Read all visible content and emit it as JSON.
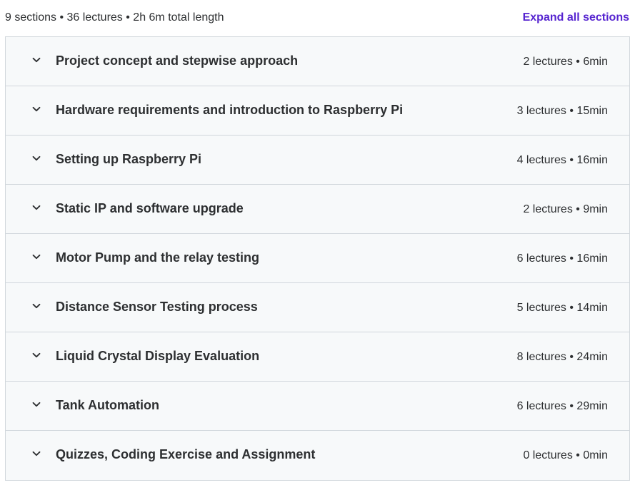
{
  "summary": {
    "text": "9 sections • 36 lectures • 2h 6m total length",
    "expand_label": "Expand all sections"
  },
  "colors": {
    "accent": "#5624d0",
    "text": "#2d2f31",
    "section_bg": "#f7f9fa",
    "border": "#d1d7dc"
  },
  "sections": [
    {
      "title": "Project concept and stepwise approach",
      "meta": "2 lectures • 6min",
      "icon": "chevron-down-icon"
    },
    {
      "title": "Hardware requirements and introduction to Raspberry Pi",
      "meta": "3 lectures • 15min",
      "icon": "chevron-down-icon"
    },
    {
      "title": "Setting up Raspberry Pi",
      "meta": "4 lectures • 16min",
      "icon": "chevron-down-icon"
    },
    {
      "title": "Static IP and software upgrade",
      "meta": "2 lectures • 9min",
      "icon": "chevron-down-icon"
    },
    {
      "title": "Motor Pump and the relay testing",
      "meta": "6 lectures • 16min",
      "icon": "chevron-down-icon"
    },
    {
      "title": "Distance Sensor Testing process",
      "meta": "5 lectures • 14min",
      "icon": "chevron-down-icon"
    },
    {
      "title": "Liquid Crystal Display Evaluation",
      "meta": "8 lectures • 24min",
      "icon": "chevron-down-icon"
    },
    {
      "title": "Tank Automation",
      "meta": "6 lectures • 29min",
      "icon": "chevron-down-icon"
    },
    {
      "title": "Quizzes, Coding Exercise and Assignment",
      "meta": "0 lectures • 0min",
      "icon": "chevron-down-icon"
    }
  ]
}
